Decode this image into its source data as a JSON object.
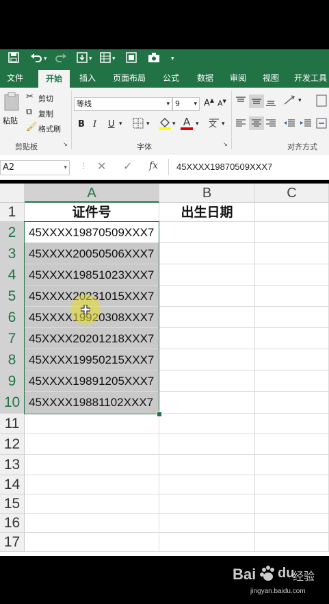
{
  "qat": {
    "save_icon": "save-icon",
    "undo_icon": "undo-icon",
    "redo_icon": "redo-icon",
    "camera_icon": "camera-icon"
  },
  "tabs": [
    {
      "label": "文件"
    },
    {
      "label": "开始"
    },
    {
      "label": "插入"
    },
    {
      "label": "页面布局"
    },
    {
      "label": "公式"
    },
    {
      "label": "数据"
    },
    {
      "label": "审阅"
    },
    {
      "label": "视图"
    },
    {
      "label": "开发工具"
    }
  ],
  "ribbon": {
    "paste_label": "粘贴",
    "cut_label": "剪切",
    "copy_label": "复制",
    "format_painter_label": "格式刷",
    "clipboard_group": "剪贴板",
    "font_name": "等线",
    "font_size": "9",
    "bold": "B",
    "italic": "I",
    "underline": "U",
    "font_color": "A",
    "grow_font": "A",
    "shrink_font": "A",
    "font_group": "字体",
    "align_group": "对齐方式"
  },
  "formula_bar": {
    "name_box": "A2",
    "fx": "fx",
    "content": "45XXXX19870509XXX7"
  },
  "grid": {
    "columns": [
      "A",
      "B",
      "C"
    ],
    "rows": [
      "1",
      "2",
      "3",
      "4",
      "5",
      "6",
      "7",
      "8",
      "9",
      "10",
      "11",
      "12",
      "13",
      "14",
      "15",
      "16",
      "17"
    ],
    "header_row": {
      "A": "证件号",
      "B": "出生日期"
    },
    "id_values": [
      "45XXXX19870509XXX7",
      "45XXXX20050506XXX7",
      "45XXXX19851023XXX7",
      "45XXXX20231015XXX7",
      "45XXXX19920308XXX7",
      "45XXXX20201218XXX7",
      "45XXXX19950215XXX7",
      "45XXXX19891205XXX7",
      "45XXXX19881102XXX7"
    ]
  },
  "watermark": {
    "brand": "Bai",
    "brand2": "du",
    "suffix": "经验",
    "url": "jingyan.baidu.com"
  },
  "colors": {
    "accent": "#217346",
    "selection": "#c9c9c9"
  }
}
